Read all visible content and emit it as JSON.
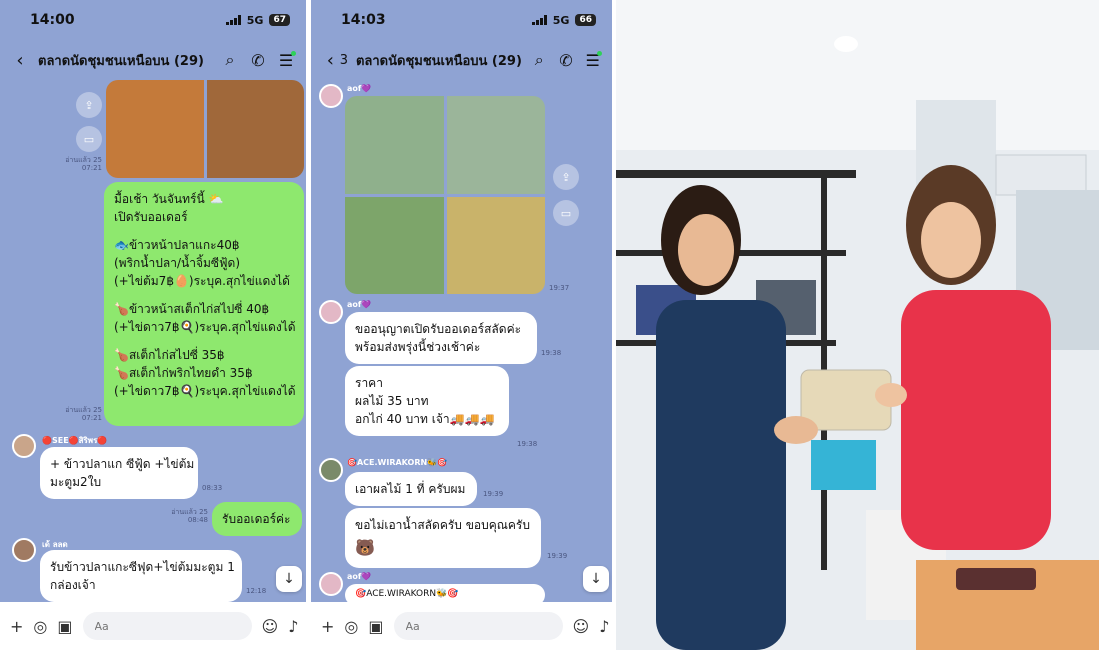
{
  "left_phone": {
    "status": {
      "time": "14:00",
      "network": "5G",
      "battery": "67"
    },
    "header": {
      "title": "ตลาดนัดชุมชนเหนือบน (29)"
    },
    "read_marks": [
      {
        "label": "อ่านแล้ว 25",
        "time": "07:21"
      },
      {
        "label": "อ่านแล้ว 25",
        "time": "07:21"
      }
    ],
    "menu_message": {
      "lines": [
        "มื้อเช้า วันจันทร์นี้ ⛅",
        "เปิดรับออเดอร์",
        "",
        "🐟ข้าวหน้าปลาแกะ40฿",
        "(พริกน้ำปลา/น้ำจิ้มซีฟู้ด)",
        "(+ไข่ต้ม7฿🥚)ระบุค.สุกไข่แดงได้",
        "",
        "🍗ข้าวหน้าสเต็กไก่สไปซี่ 40฿",
        "(+ไข่ดาว7฿🍳)ระบุค.สุกไข่แดงได้",
        "",
        "🍗สเต็กไก่สไปซี่ 35฿",
        "🍗สเต็กไก่พริกไทยดำ 35฿",
        "(+ไข่ดาว7฿🍳)ระบุค.สุกไข่แดงได้"
      ]
    },
    "msg_see": {
      "sender": "🔴SEE🔴สิริพร🔴",
      "lines": [
        "+ ข้าวปลาแก ซีฟู้ด +ไข่ต้ม",
        "มะตูม2ใบ"
      ],
      "time": "08:33"
    },
    "reply_mine": {
      "text": "รับออเดอร์ค่ะ",
      "read": "อ่านแล้ว 25",
      "time": "08:48"
    },
    "msg_lastone": {
      "sender": "เด้ ลลด",
      "lines": [
        "รับข้าวปลาแกะซีฟุด+ไข่ต้มมะตูม 1",
        "กล่องเจ้า"
      ],
      "time": "12:18"
    },
    "input_placeholder": "Aa"
  },
  "right_phone": {
    "status": {
      "time": "14:03",
      "network": "5G",
      "battery": "66"
    },
    "header": {
      "back_count": "3",
      "title": "ตลาดนัดชุมชนเหนือบน (29)"
    },
    "msg_aof_photos": {
      "sender": "aof💜",
      "time": "19:37"
    },
    "msg_aof_text1": {
      "sender": "aof💜",
      "lines": [
        "ขออนุญาตเปิดรับออเดอร์สลัดค่ะ",
        "พร้อมส่งพรุ่งนี้ช่วงเช้าค่ะ"
      ],
      "time": "19:38"
    },
    "msg_aof_text2": {
      "lines": [
        "ราคา",
        "ผลไม้ 35 บาท",
        "อกไก่ 40 บาท เจ้า🚚🚚🚚"
      ],
      "time": "19:38"
    },
    "msg_ace": {
      "sender": "🎯ACE.WIRAKORN🐝🎯",
      "lines": [
        "เอาผลไม้ 1 ที่ ครับผม"
      ],
      "time": "19:39"
    },
    "msg_ace2": {
      "lines": [
        "ขอไม่เอาน้ำสลัดครับ ขอบคุณครับ"
      ],
      "emoji": "🐻",
      "time": "19:39"
    },
    "msg_aof_last": {
      "sender": "aof💜",
      "quote": "🎯ACE.WIRAKORN🐝🎯"
    },
    "input_placeholder": "Aa"
  },
  "icons": {
    "back": "chevron-left-icon",
    "search": "search-icon",
    "call": "phone-icon",
    "menu": "menu-icon",
    "plus": "plus-icon",
    "camera": "camera-icon",
    "gallery": "image-icon",
    "emoji": "emoji-icon",
    "mic": "mic-icon",
    "share": "share-icon",
    "scroll_down": "arrow-down-icon"
  },
  "colors": {
    "chat_background": "#8fa3d3",
    "my_bubble": "#8ee86e",
    "their_bubble": "#ffffff"
  }
}
